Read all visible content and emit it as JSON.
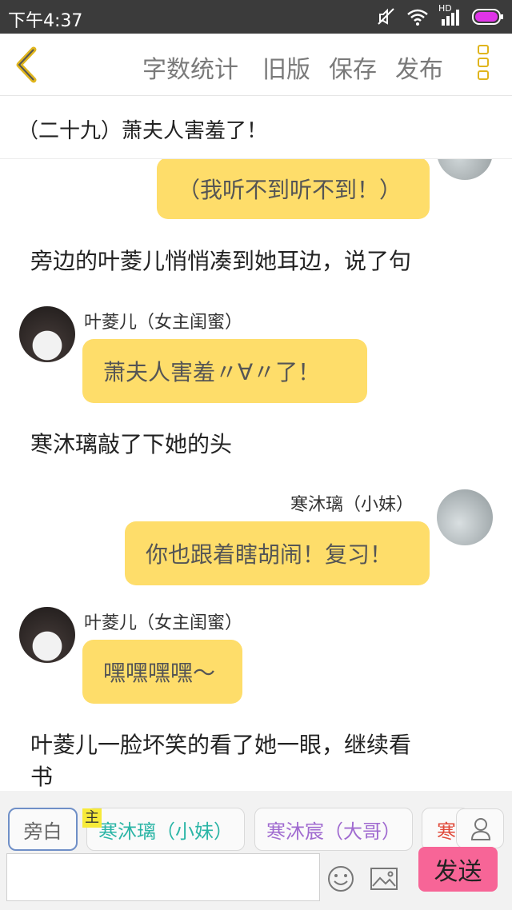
{
  "status_bar": {
    "time": "下午4:37",
    "network": "HD"
  },
  "toolbar": {
    "word_count": "字数统计",
    "old_version": "旧版",
    "save": "保存",
    "publish": "发布"
  },
  "chapter": {
    "title": "（二十九）萧夫人害羞了！"
  },
  "messages": [
    {
      "type": "bubble",
      "side": "right",
      "text": "（我听不到听不到！）"
    },
    {
      "type": "narration",
      "text": "旁边的叶菱儿悄悄凑到她耳边，说了句"
    },
    {
      "type": "bubble",
      "side": "left",
      "name": "叶菱儿（女主闺蜜）",
      "text": "萧夫人害羞〃∀〃了！"
    },
    {
      "type": "narration",
      "text": "寒沐璃敲了下她的头"
    },
    {
      "type": "bubble",
      "side": "right",
      "name": "寒沐璃（小妹）",
      "text": "你也跟着瞎胡闹！复习！"
    },
    {
      "type": "bubble",
      "side": "left",
      "name": "叶菱儿（女主闺蜜）",
      "text": "嘿嘿嘿嘿～"
    },
    {
      "type": "narration",
      "text_line1": "叶菱儿一脸坏笑的看了她一眼，继续看",
      "text_line2": "书"
    }
  ],
  "characters": {
    "narrator": "旁白",
    "main_tag": "主",
    "c1": "寒沐璃（小妹）",
    "c2": "寒沐宸（大哥）",
    "c3": "寒"
  },
  "colors": {
    "bubble": "#fedd6a",
    "accent": "#e0b51d",
    "send": "#f76597",
    "c1_color": "#2bb5a6",
    "c2_color": "#a06bd0",
    "c3_color": "#e04a3a"
  },
  "composer": {
    "placeholder": "",
    "send": "发送"
  }
}
